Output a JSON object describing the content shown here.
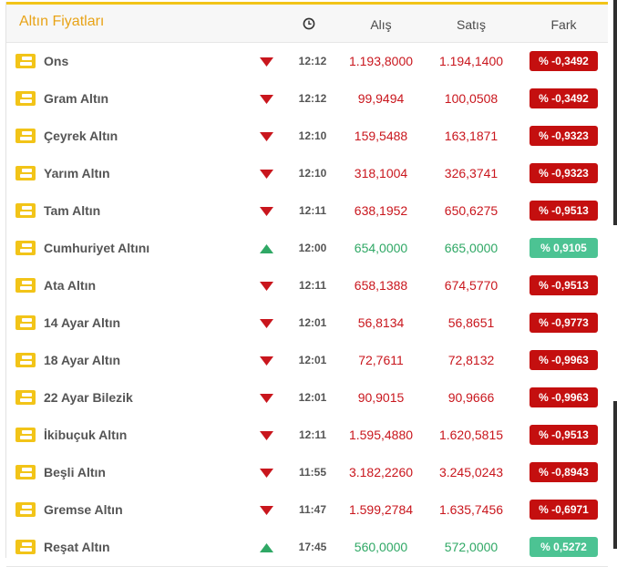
{
  "header": {
    "title": "Altın Fiyatları",
    "clock_icon": "clock-icon",
    "col_buy": "Alış",
    "col_sell": "Satış",
    "col_diff": "Fark"
  },
  "colors": {
    "title": "#e8a317",
    "down": "#c9161d",
    "up": "#2fa865",
    "badge_down": "#c40f0f",
    "badge_up": "#4cc393"
  },
  "rows": [
    {
      "name": "Ons",
      "dir": "down",
      "time": "12:12",
      "buy": "1.193,8000",
      "sell": "1.194,1400",
      "diff": "% -0,3492"
    },
    {
      "name": "Gram Altın",
      "dir": "down",
      "time": "12:12",
      "buy": "99,9494",
      "sell": "100,0508",
      "diff": "% -0,3492"
    },
    {
      "name": "Çeyrek Altın",
      "dir": "down",
      "time": "12:10",
      "buy": "159,5488",
      "sell": "163,1871",
      "diff": "% -0,9323"
    },
    {
      "name": "Yarım Altın",
      "dir": "down",
      "time": "12:10",
      "buy": "318,1004",
      "sell": "326,3741",
      "diff": "% -0,9323"
    },
    {
      "name": "Tam Altın",
      "dir": "down",
      "time": "12:11",
      "buy": "638,1952",
      "sell": "650,6275",
      "diff": "% -0,9513"
    },
    {
      "name": "Cumhuriyet Altını",
      "dir": "up",
      "time": "12:00",
      "buy": "654,0000",
      "sell": "665,0000",
      "diff": "% 0,9105"
    },
    {
      "name": "Ata Altın",
      "dir": "down",
      "time": "12:11",
      "buy": "658,1388",
      "sell": "674,5770",
      "diff": "% -0,9513"
    },
    {
      "name": "14 Ayar Altın",
      "dir": "down",
      "time": "12:01",
      "buy": "56,8134",
      "sell": "56,8651",
      "diff": "% -0,9773"
    },
    {
      "name": "18 Ayar Altın",
      "dir": "down",
      "time": "12:01",
      "buy": "72,7611",
      "sell": "72,8132",
      "diff": "% -0,9963"
    },
    {
      "name": "22 Ayar Bilezik",
      "dir": "down",
      "time": "12:01",
      "buy": "90,9015",
      "sell": "90,9666",
      "diff": "% -0,9963"
    },
    {
      "name": "İkibuçuk Altın",
      "dir": "down",
      "time": "12:11",
      "buy": "1.595,4880",
      "sell": "1.620,5815",
      "diff": "% -0,9513"
    },
    {
      "name": "Beşli Altın",
      "dir": "down",
      "time": "11:55",
      "buy": "3.182,2260",
      "sell": "3.245,0243",
      "diff": "% -0,8943"
    },
    {
      "name": "Gremse Altın",
      "dir": "down",
      "time": "11:47",
      "buy": "1.599,2784",
      "sell": "1.635,7456",
      "diff": "% -0,6971"
    },
    {
      "name": "Reşat Altın",
      "dir": "up",
      "time": "17:45",
      "buy": "560,0000",
      "sell": "572,0000",
      "diff": "% 0,5272"
    }
  ]
}
